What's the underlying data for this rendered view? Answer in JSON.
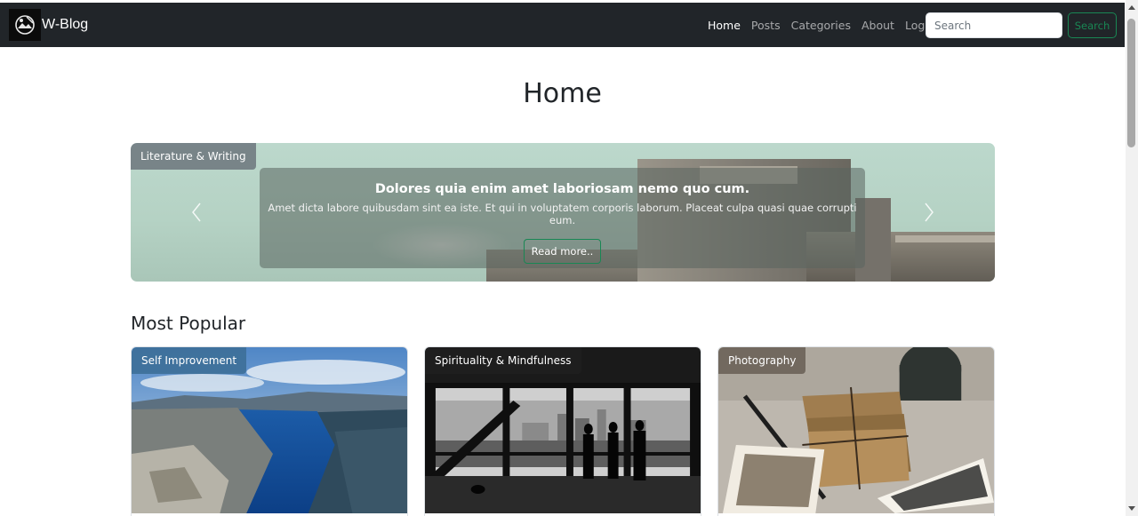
{
  "navbar": {
    "brand": "W-Blog",
    "links": [
      {
        "label": "Home",
        "active": true
      },
      {
        "label": "Posts",
        "active": false
      },
      {
        "label": "Categories",
        "active": false
      },
      {
        "label": "About",
        "active": false
      },
      {
        "label": "Login",
        "active": false
      }
    ],
    "search_placeholder": "Search",
    "search_button": "Search"
  },
  "page_title": "Home",
  "carousel": {
    "category": "Literature & Writing",
    "title": "Dolores quia enim amet laboriosam nemo quo cum.",
    "text": "Amet dicta labore quibusdam sint ea iste. Et qui in voluptatem corporis laborum. Placeat culpa quasi quae corrupti eum.",
    "button": "Read more..",
    "prev_icon": "chevron-left-icon",
    "next_icon": "chevron-right-icon"
  },
  "most_popular": {
    "title": "Most Popular",
    "cards": [
      {
        "category": "Self Improvement",
        "image": "fjord-landscape",
        "badge_color": "#3d6f98"
      },
      {
        "category": "Spirituality & Mindfulness",
        "image": "city-window-silhouettes",
        "badge_color": "#1f1f1f"
      },
      {
        "category": "Photography",
        "image": "letters-and-photos",
        "badge_color": "#6b6359"
      }
    ]
  },
  "colors": {
    "navbar_bg": "#212529",
    "accent_green": "#198754"
  }
}
